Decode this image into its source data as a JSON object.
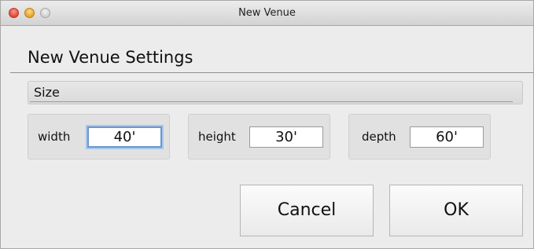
{
  "window": {
    "title": "New Venue"
  },
  "dialog": {
    "heading": "New Venue Settings",
    "section_label": "Size",
    "fields": {
      "width": {
        "label": "width",
        "value": "40'"
      },
      "height": {
        "label": "height",
        "value": "30'"
      },
      "depth": {
        "label": "depth",
        "value": "60'"
      }
    },
    "buttons": {
      "cancel": "Cancel",
      "ok": "OK"
    }
  },
  "colors": {
    "window_bg": "#ececec",
    "focus_ring": "#6b97cf",
    "close": "#e0443a",
    "minimize": "#e3a325",
    "zoom": "#cfcfcf"
  }
}
